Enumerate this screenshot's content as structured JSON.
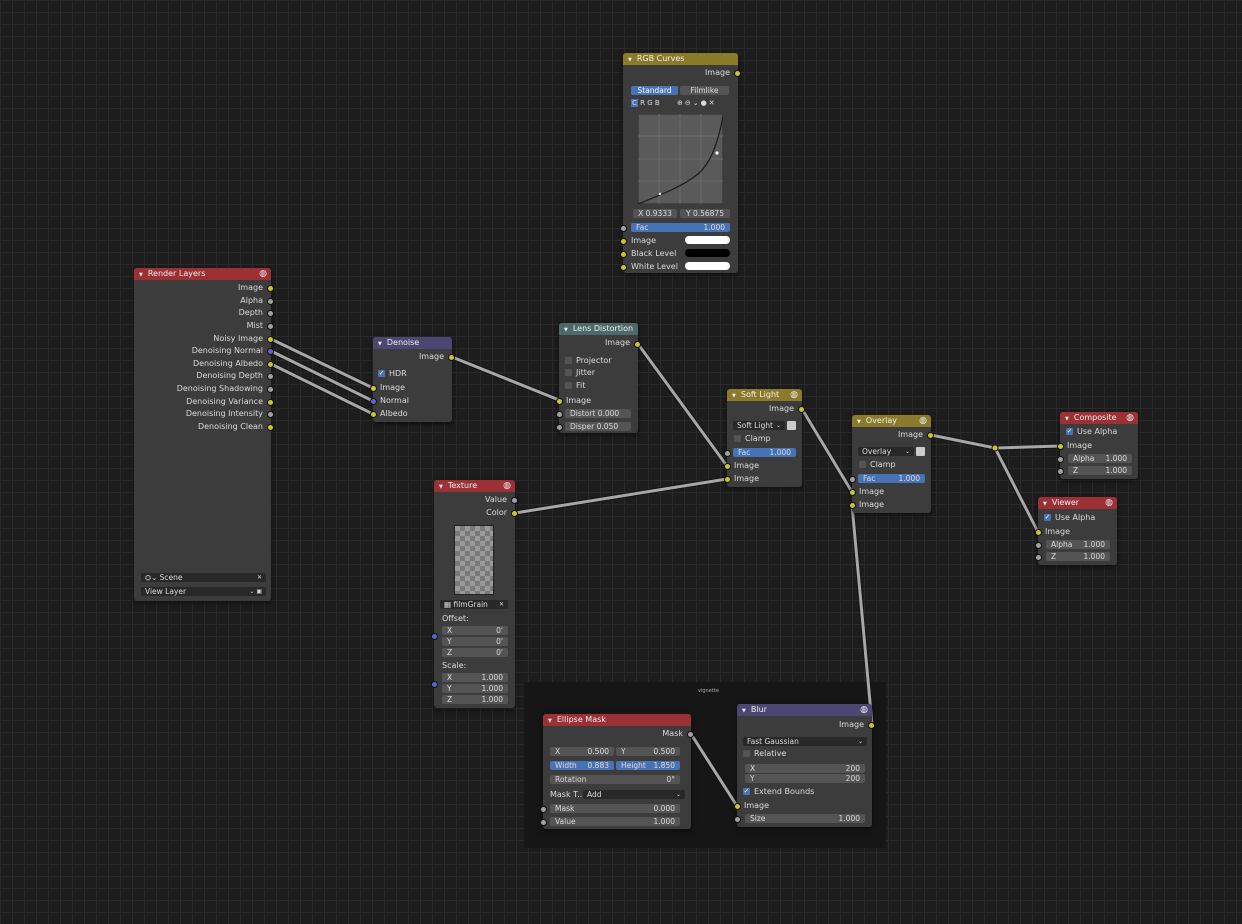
{
  "frame": {
    "label": "vignette"
  },
  "colors": {
    "socket_color": "#c7c729",
    "socket_float": "#a1a1a1",
    "socket_vector": "#6363c7",
    "header_input": "#9b3035",
    "header_color": "#8a7a2a",
    "header_filter": "#4c4772",
    "header_distort": "#4e6a68",
    "accent": "#4772b3"
  },
  "render_layers": {
    "title": "Render Layers",
    "outputs": [
      "Image",
      "Alpha",
      "Depth",
      "Mist",
      "Noisy Image",
      "Denoising Normal",
      "Denoising Albedo",
      "Denoising Depth",
      "Denoising Shadowing",
      "Denoising Variance",
      "Denoising Intensity",
      "Denoising Clean"
    ],
    "scene": "Scene",
    "view_layer": "View Layer"
  },
  "denoise": {
    "title": "Denoise",
    "output": "Image",
    "hdr_label": "HDR",
    "inputs": [
      "Image",
      "Normal",
      "Albedo"
    ]
  },
  "lens": {
    "title": "Lens Distortion",
    "output": "Image",
    "opts": [
      "Projector",
      "Jitter",
      "Fit"
    ],
    "input": "Image",
    "distort_label": "Distort",
    "distort_value": "0.000",
    "disper_label": "Disper",
    "disper_value": "0.050"
  },
  "rgb_curves": {
    "title": "RGB Curves",
    "output": "Image",
    "tab_standard": "Standard",
    "tab_filmlike": "Filmlike",
    "channels": [
      "C",
      "R",
      "G",
      "B"
    ],
    "x_readout": "X 0.9333",
    "y_readout": "Y 0.56875",
    "fac_label": "Fac",
    "fac_value": "1.000",
    "inputs": [
      "Image",
      "Black Level",
      "White Level"
    ]
  },
  "texture": {
    "title": "Texture",
    "outputs": [
      "Value",
      "Color"
    ],
    "tex_name": "filmGrain",
    "offset_label": "Offset:",
    "offset": [
      {
        "axis": "X",
        "value": "0'"
      },
      {
        "axis": "Y",
        "value": "0'"
      },
      {
        "axis": "Z",
        "value": "0'"
      }
    ],
    "scale_label": "Scale:",
    "scale": [
      {
        "axis": "X",
        "value": "1.000"
      },
      {
        "axis": "Y",
        "value": "1.000"
      },
      {
        "axis": "Z",
        "value": "1.000"
      }
    ]
  },
  "soft_light": {
    "title": "Soft Light",
    "output": "Image",
    "blend": "Soft Light",
    "clamp": "Clamp",
    "fac_label": "Fac",
    "fac_value": "1.000",
    "inputs": [
      "Image",
      "Image"
    ]
  },
  "overlay": {
    "title": "Overlay",
    "output": "Image",
    "blend": "Overlay",
    "clamp": "Clamp",
    "fac_label": "Fac",
    "fac_value": "1.000",
    "inputs": [
      "Image",
      "Image"
    ]
  },
  "composite": {
    "title": "Composite",
    "use_alpha": "Use Alpha",
    "input": "Image",
    "alpha_label": "Alpha",
    "alpha_value": "1.000",
    "z_label": "Z",
    "z_value": "1.000"
  },
  "viewer": {
    "title": "Viewer",
    "use_alpha": "Use Alpha",
    "input": "Image",
    "alpha_label": "Alpha",
    "alpha_value": "1.000",
    "z_label": "Z",
    "z_value": "1.000"
  },
  "ellipse": {
    "title": "Ellipse Mask",
    "output": "Mask",
    "x_label": "X",
    "x_value": "0.500",
    "y_label": "Y",
    "y_value": "0.500",
    "width_label": "Width",
    "width_value": "0.883",
    "height_label": "Height",
    "height_value": "1.850",
    "rotation_label": "Rotation",
    "rotation_value": "0°",
    "mask_type_label": "Mask T...",
    "mask_type_value": "Add",
    "mask_label": "Mask",
    "mask_value": "0.000",
    "value_label": "Value",
    "value_value": "1.000"
  },
  "blur": {
    "title": "Blur",
    "output": "Image",
    "filter": "Fast Gaussian",
    "relative": "Relative",
    "x_label": "X",
    "x_value": "200",
    "y_label": "Y",
    "y_value": "200",
    "extend": "Extend Bounds",
    "input": "Image",
    "size_label": "Size",
    "size_value": "1.000"
  }
}
